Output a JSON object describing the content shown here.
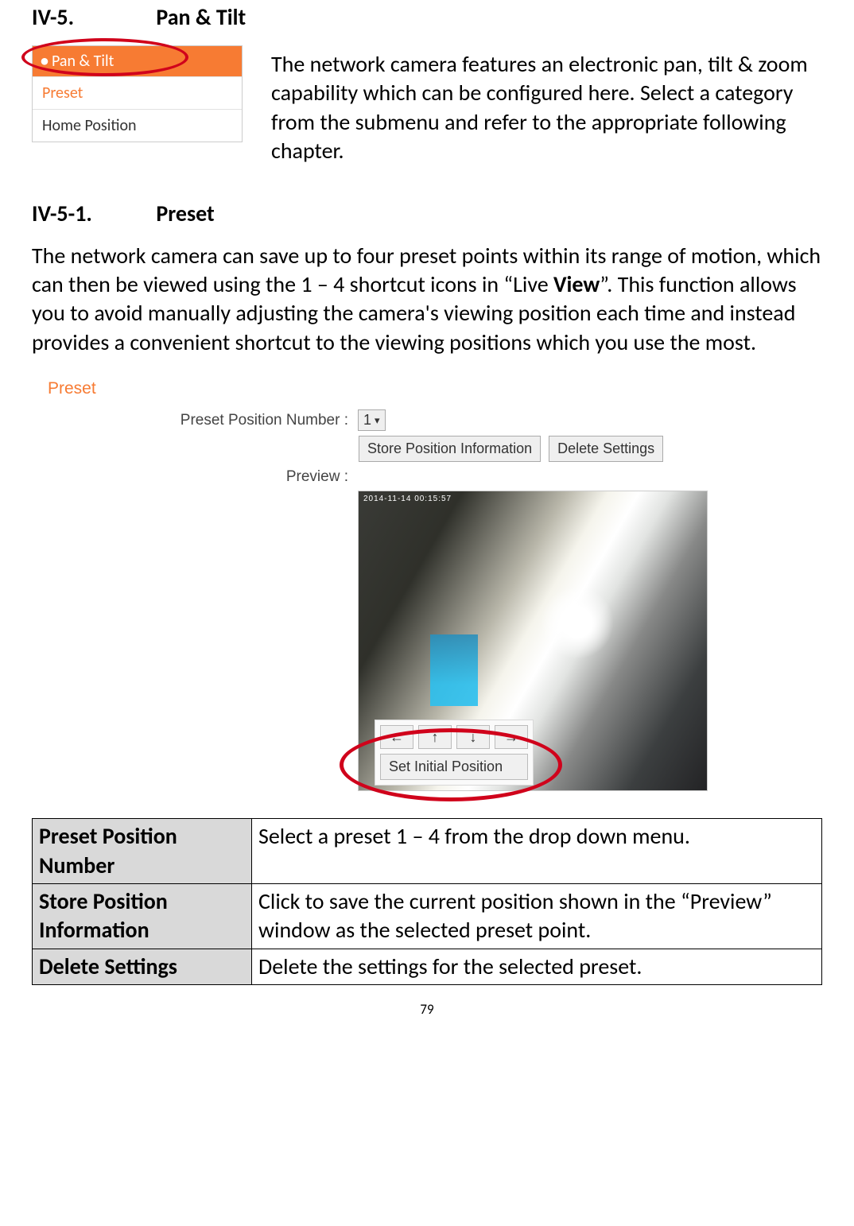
{
  "section1": {
    "number": "IV-5.",
    "title": "Pan & Tilt"
  },
  "submenu": {
    "header": "Pan & Tilt",
    "items": [
      "Preset",
      "Home Position"
    ]
  },
  "intro": "The network camera features an electronic pan, tilt & zoom capability which can be configured here. Select a category from the submenu and refer to the appropriate following chapter.",
  "section2": {
    "number": "IV-5-1.",
    "title": "Preset"
  },
  "paragraph": {
    "p1": "The network camera can save up to four preset points within its range of motion, which can then be viewed using the 1 – 4 shortcut icons in “Live ",
    "bold": "View",
    "p2": "”. This function allows you to avoid manually adjusting the camera's viewing position each time and instead provides a convenient shortcut to the viewing positions which you use the most."
  },
  "presetPanel": {
    "title": "Preset",
    "rowLabel1": "Preset Position Number :",
    "dropdownValue": "1",
    "storeBtn": "Store Position Information",
    "deleteBtn": "Delete Settings",
    "rowLabel2": "Preview :",
    "timestamp": "2014-11-14  00:15:57",
    "arrows": {
      "left": "←",
      "up": "↑",
      "down": "↓",
      "right": "→"
    },
    "setInitial": "Set Initial Position"
  },
  "table": {
    "rows": [
      {
        "h": "Preset Position Number",
        "d": "Select a preset 1 – 4 from the drop down menu."
      },
      {
        "h": "Store Position Information",
        "d": "Click to save the current position shown in the “Preview” window as the selected preset point."
      },
      {
        "h": "Delete Settings",
        "d": "Delete the settings for the selected preset."
      }
    ]
  },
  "pageNumber": "79"
}
